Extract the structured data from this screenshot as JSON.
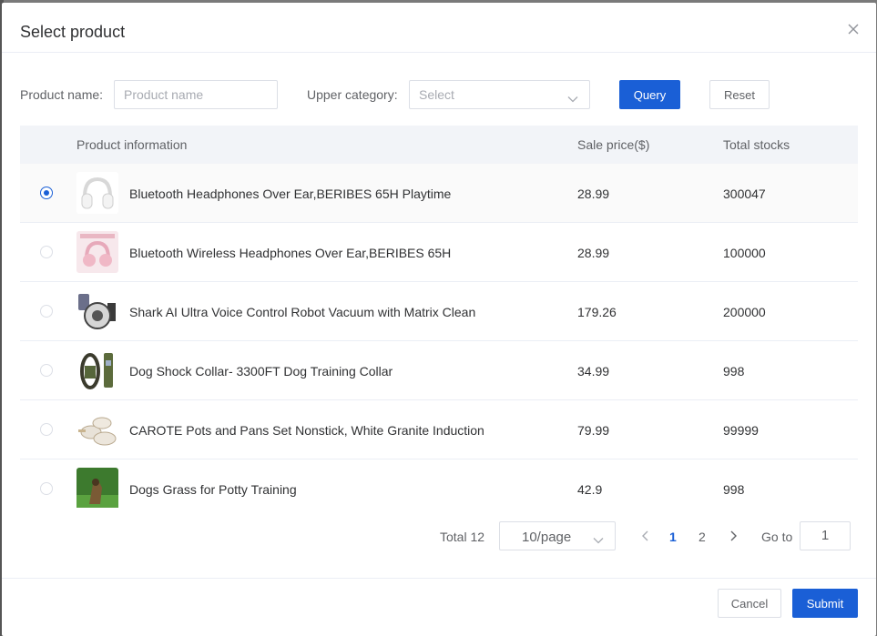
{
  "dialog": {
    "title": "Select product"
  },
  "filters": {
    "product_name_label": "Product name:",
    "product_name_placeholder": "Product name",
    "category_label": "Upper category:",
    "category_value": "Select",
    "query_label": "Query",
    "reset_label": "Reset"
  },
  "table": {
    "headers": {
      "info": "Product information",
      "price": "Sale price($)",
      "stock": "Total stocks"
    },
    "rows": [
      {
        "name": "Bluetooth Headphones Over Ear,BERIBES 65H Playtime",
        "price": "28.99",
        "stock": "300047",
        "selected": true,
        "image": "white-headphones-image"
      },
      {
        "name": "Bluetooth Wireless Headphones Over Ear,BERIBES 65H",
        "price": "28.99",
        "stock": "100000",
        "selected": false,
        "image": "pink-headphones-image"
      },
      {
        "name": "Shark AI Ultra Voice Control Robot Vacuum with Matrix Clean",
        "price": "179.26",
        "stock": "200000",
        "selected": false,
        "image": "robot-vacuum-image"
      },
      {
        "name": "Dog Shock Collar- 3300FT Dog Training Collar",
        "price": "34.99",
        "stock": "998",
        "selected": false,
        "image": "dog-collar-image"
      },
      {
        "name": "CAROTE Pots and Pans Set Nonstick, White Granite Induction",
        "price": "79.99",
        "stock": "99999",
        "selected": false,
        "image": "cookware-set-image"
      },
      {
        "name": "Dogs Grass for Potty Training",
        "price": "42.9",
        "stock": "998",
        "selected": false,
        "image": "dog-grass-image"
      }
    ]
  },
  "pagination": {
    "total": "Total 12",
    "page_size": "10/page",
    "pages": [
      "1",
      "2"
    ],
    "current_page": "1",
    "goto_label": "Go to",
    "goto_value": "1"
  },
  "footer": {
    "cancel_label": "Cancel",
    "submit_label": "Submit"
  },
  "colors": {
    "primary": "#1a5fd6",
    "header_bg": "#f2f4f8",
    "border": "#dcdfe6"
  }
}
